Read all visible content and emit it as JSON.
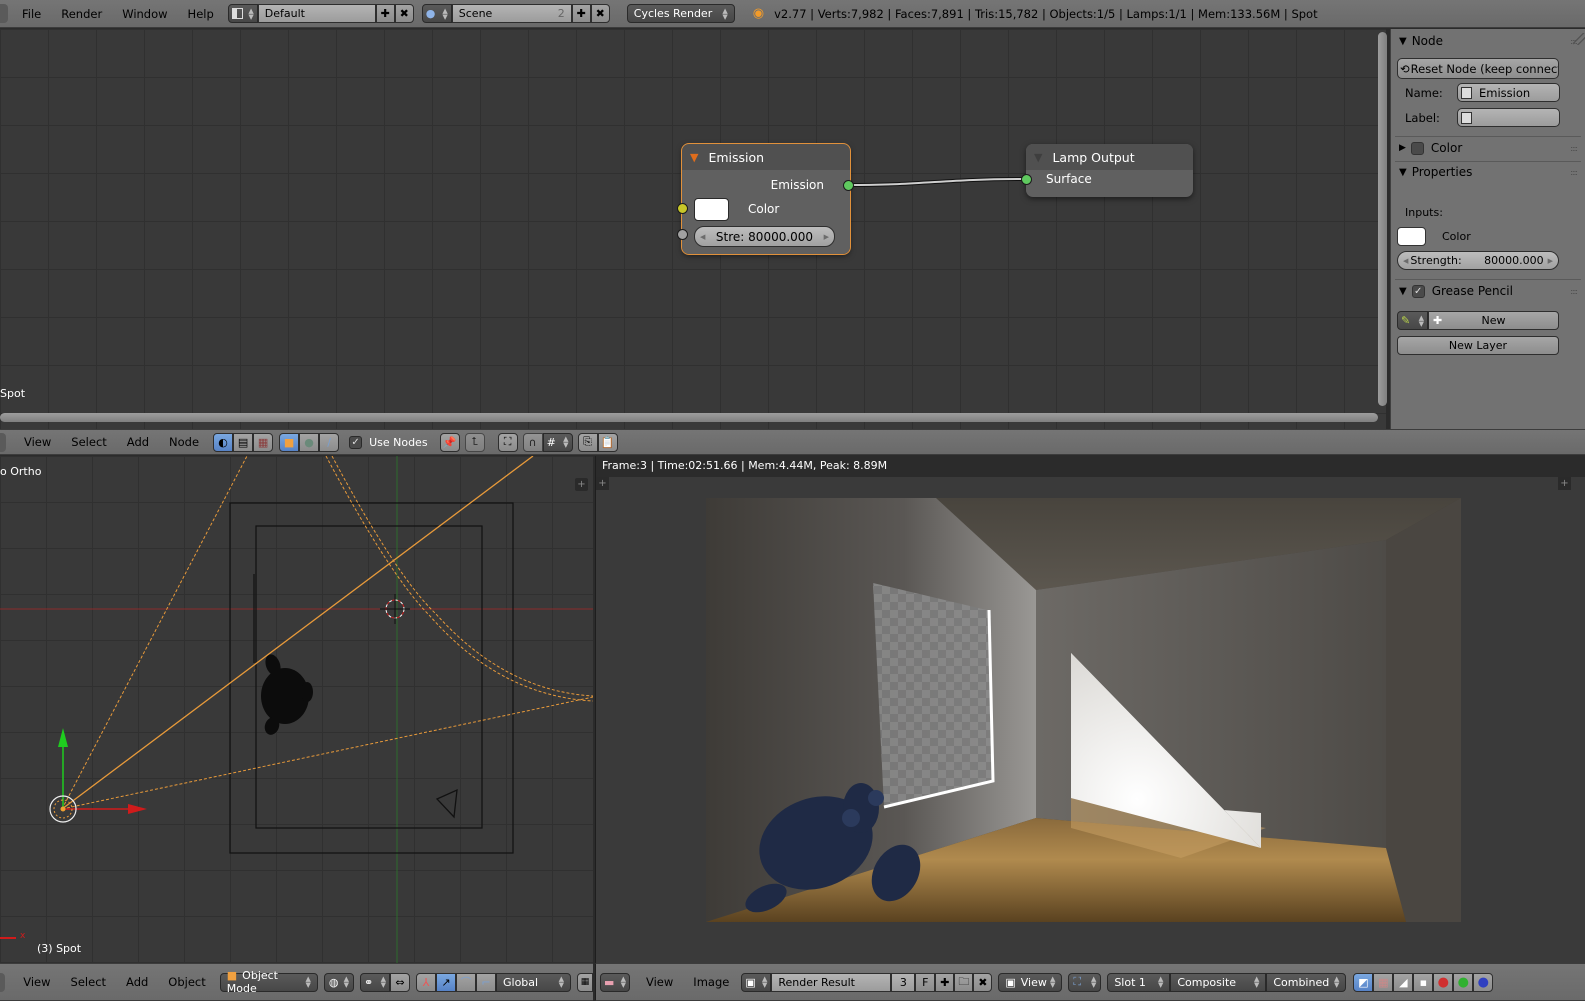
{
  "topbar": {
    "menus": [
      "File",
      "Render",
      "Window",
      "Help"
    ],
    "screen_layout": "Default",
    "scene": "Scene",
    "scene_users": "2",
    "render_engine": "Cycles Render",
    "stats": "v2.77 | Verts:7,982 | Faces:7,891 | Tris:15,782 | Objects:1/5 | Lamps:1/1 | Mem:133.56M | Spot"
  },
  "node_editor": {
    "object_label": "Spot",
    "nodes": {
      "emission": {
        "title": "Emission",
        "output": "Emission",
        "color_label": "Color",
        "color_value": "#ffffff",
        "strength_label": "Stre:",
        "strength_value": "80000.000"
      },
      "lamp_output": {
        "title": "Lamp Output",
        "input": "Surface"
      }
    }
  },
  "sidebar": {
    "node_section": "Node",
    "reset_node": "Reset Node (keep connecti...",
    "name_label": "Name:",
    "name_value": "Emission",
    "label_label": "Label:",
    "label_value": "",
    "color_section": "Color",
    "properties_section": "Properties",
    "inputs_label": "Inputs:",
    "color_label": "Color",
    "strength_label": "Strength:",
    "strength_value": "80000.000",
    "grease_pencil_section": "Grease Pencil",
    "grease_pencil_enabled": true,
    "new_button": "New",
    "new_layer_button": "New Layer"
  },
  "node_header": {
    "menus": [
      "View",
      "Select",
      "Add",
      "Node"
    ],
    "use_nodes_label": "Use Nodes",
    "use_nodes_checked": true
  },
  "viewport3d": {
    "view_label": "o Ortho",
    "object_info": "(3) Spot",
    "axis_label": "x",
    "menus": [
      "View",
      "Select",
      "Add",
      "Object"
    ],
    "mode": "Object Mode",
    "orientation": "Global"
  },
  "image_editor": {
    "render_info": "Frame:3 | Time:02:51.66 | Mem:4.44M, Peak: 8.89M",
    "menus": [
      "View",
      "Image"
    ],
    "image_name": "Render Result",
    "image_users": "3",
    "fake_user": "F",
    "view": "View",
    "slot": "Slot 1",
    "layer": "Composite",
    "pass": "Combined"
  },
  "colors": {
    "accent_blue": "#5682c6",
    "socket_green": "#5fc95f",
    "socket_yellow": "#c7c729",
    "socket_gray": "#a1a1a1",
    "node_selected_outline": "#e1913b",
    "light_cone": "#e89a3a"
  }
}
